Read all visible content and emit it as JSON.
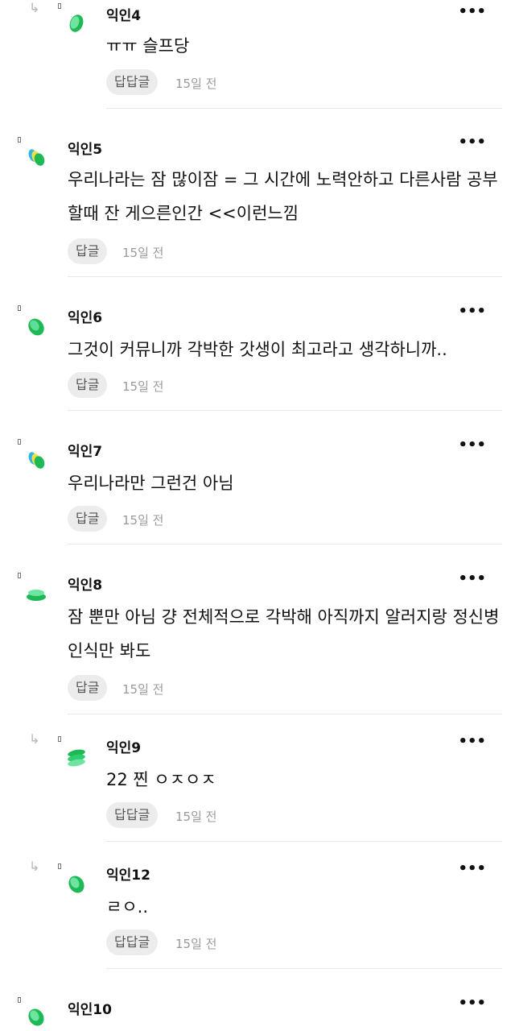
{
  "comments": [
    {
      "name": "익인4",
      "text": "ㅠㅠ 슬프당",
      "reply_label": "답답글",
      "time": "15일 전",
      "nested": true
    },
    {
      "name": "익인5",
      "text": "우리나라는 잠 많이잠 = 그 시간에 노력안하고 다른사람 공부할때 잔 게으른인간 <<이런느낌",
      "reply_label": "답글",
      "time": "15일 전",
      "nested": false
    },
    {
      "name": "익인6",
      "text": "그것이 커뮤니까 각박한 갓생이 최고라고 생각하니까..",
      "reply_label": "답글",
      "time": "15일 전",
      "nested": false
    },
    {
      "name": "익인7",
      "text": "우리나라만 그런건 아님",
      "reply_label": "답글",
      "time": "15일 전",
      "nested": false
    },
    {
      "name": "익인8",
      "text": "잠 뿐만 아님 걍 전체적으로 각박해 아직까지 알러지랑 정신병 인식만 봐도",
      "reply_label": "답글",
      "time": "15일 전",
      "nested": false
    },
    {
      "name": "익인9",
      "text": "22 찐 ㅇㅈㅇㅈ",
      "reply_label": "답답글",
      "time": "15일 전",
      "nested": true
    },
    {
      "name": "익인12",
      "text": "ㄹㅇ..",
      "reply_label": "답답글",
      "time": "15일 전",
      "nested": true
    },
    {
      "name": "익인10",
      "text": "",
      "reply_label": "",
      "time": "",
      "nested": false
    }
  ],
  "icons": {
    "reply_arrow": "reply-arrow-icon",
    "more": "more-options-icon",
    "avatar_color": "#2ecc71"
  },
  "more_glyph": "•••",
  "reply_arrow_glyph": "↳"
}
